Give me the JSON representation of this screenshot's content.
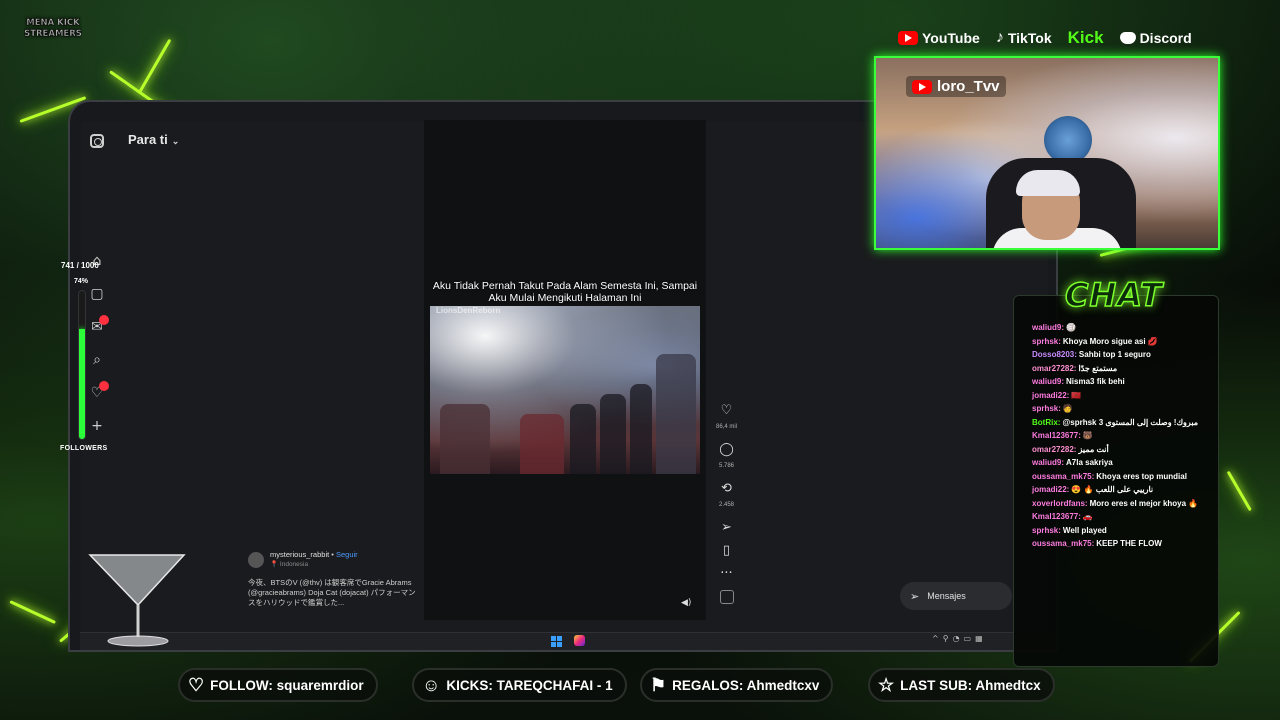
{
  "overlay": {
    "logo_text": "MENA KICK STREAMERS",
    "socials": [
      {
        "name": "YouTube",
        "icon": "youtube-icon"
      },
      {
        "name": "TikTok",
        "icon": "tiktok-icon"
      },
      {
        "name": "Kick",
        "icon": "kick-logo"
      },
      {
        "name": "Discord",
        "icon": "discord-icon"
      }
    ],
    "follower_goal": {
      "count": "741 / 1000",
      "percent_label": "74%",
      "progress": 0.741,
      "label": "FOLLOWERS"
    },
    "webcam": {
      "channel_name": "loro_Tvv"
    },
    "chat": {
      "title": "CHAT",
      "messages": [
        {
          "user": "waliud9:",
          "text": "🏐",
          "color": "#ff7ce0"
        },
        {
          "user": "sprhsk:",
          "text": "Khoya Moro sigue asi 💋",
          "color": "#ff7ce0"
        },
        {
          "user": "Dosso8203:",
          "text": "Sahbi top 1 seguro",
          "color": "#c98bff"
        },
        {
          "user": "omar27282:",
          "text": "مستمتع جدًا",
          "color": "#ff8fd1"
        },
        {
          "user": "waliud9:",
          "text": "Nisma3 fik behi",
          "color": "#ff7ce0"
        },
        {
          "user": "jomadi22:",
          "text": "🇲🇦",
          "color": "#ff7ce0"
        },
        {
          "user": "sprhsk:",
          "text": "🧑",
          "color": "#ff7ce0"
        },
        {
          "user": "BotRix:",
          "text": "@sprhsk مبروك! وصلت إلى المستوى 3",
          "color": "#53fc18"
        },
        {
          "user": "Kmal123677:",
          "text": "🐻",
          "color": "#ff7ce0"
        },
        {
          "user": "omar27282:",
          "text": "أنت مميز",
          "color": "#ff8fd1"
        },
        {
          "user": "waliud9:",
          "text": "A7la sakriya",
          "color": "#ff7ce0"
        },
        {
          "user": "oussama_mk75:",
          "text": "Khoya eres top mundial",
          "color": "#ff7ce0"
        },
        {
          "user": "jomadi22:",
          "text": "😍 🔥 نارييي على اللعب",
          "color": "#ff7ce0"
        },
        {
          "user": "xoverlordfans:",
          "text": "Moro eres el mejor khoya 🔥",
          "color": "#ff7ce0"
        },
        {
          "user": "Kmal123677:",
          "text": "🚗",
          "color": "#ff7ce0"
        },
        {
          "user": "sprhsk:",
          "text": "Well played",
          "color": "#ff7ce0"
        },
        {
          "user": "oussama_mk75:",
          "text": "KEEP THE FLOW",
          "color": "#ff7ce0"
        }
      ]
    },
    "bottom_bar": [
      {
        "label": "FOLLOW: squaremrdior",
        "icon": "heart-icon"
      },
      {
        "label": "KICKS: TAREQCHAFAI - 1",
        "icon": "user-icon"
      },
      {
        "label": "REGALOS: Ahmedtcxv",
        "icon": "gift-icon"
      },
      {
        "label": "LAST SUB: Ahmedtcx",
        "icon": "star-icon"
      }
    ]
  },
  "instagram": {
    "feed_title": "Para ti",
    "video": {
      "caption": "Aku Tidak Pernah Takut Pada Alam Semesta Ini, Sampai Aku Mulai Mengikuti Halaman Ini",
      "watermark": "LionsDenReborn"
    },
    "actions": {
      "likes": "86,4 mil",
      "comments": "5.786",
      "reposts": "2.458"
    },
    "post": {
      "author": "mysterious_rabbit",
      "follow_label": "Seguir",
      "location": "Indonesia",
      "description": "今夜、BTSのV (@thv) は観客席でGracie Abrams (@gracieabrams) Doja Cat (dojacat) パフォーマンスをハリウッドで鑑賞した..."
    },
    "messages_label": "Mensajes"
  }
}
